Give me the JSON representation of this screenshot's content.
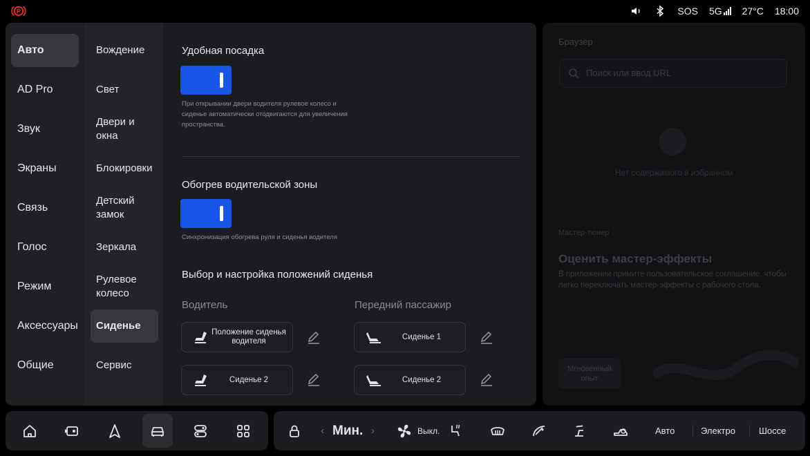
{
  "status_bar": {
    "logo_icon": "parking-brake-icon",
    "volume_icon": "speaker-icon",
    "bluetooth_icon": "bluetooth-icon",
    "sos": "SOS",
    "network": "5G",
    "temperature": "27°C",
    "time": "18:00"
  },
  "nav_primary": {
    "items": [
      {
        "label": "Авто",
        "active": true
      },
      {
        "label": "AD Pro"
      },
      {
        "label": "Звук"
      },
      {
        "label": "Экраны"
      },
      {
        "label": "Связь"
      },
      {
        "label": "Голос"
      },
      {
        "label": "Режим"
      },
      {
        "label": "Аксессуары"
      },
      {
        "label": "Общие"
      }
    ]
  },
  "nav_secondary": {
    "items": [
      {
        "label": "Вождение"
      },
      {
        "label": "Свет"
      },
      {
        "label": "Двери и окна"
      },
      {
        "label": "Блокировки"
      },
      {
        "label": "Детский замок"
      },
      {
        "label": "Зеркала"
      },
      {
        "label": "Рулевое колесо"
      },
      {
        "label": "Сиденье",
        "active": true
      },
      {
        "label": "Сервис"
      }
    ]
  },
  "settings": {
    "easy_entry": {
      "title": "Удобная посадка",
      "enabled": true,
      "description": "При открывании двери водителя рулевое колесо и сиденье автоматически отодвигаются для увеличения пространства."
    },
    "driver_heating": {
      "title": "Обогрев водительской зоны",
      "enabled": true,
      "description": "Синхронизация обогрева руля и сиденья водителя"
    },
    "seat_positions": {
      "title": "Выбор и настройка положений сиденья",
      "driver_header": "Водитель",
      "passenger_header": "Передний пассажир",
      "driver_buttons": [
        "Положение сиденья водителя",
        "Сиденье 2"
      ],
      "passenger_buttons": [
        "Сиденье 1",
        "Сиденье 2"
      ]
    }
  },
  "widget": {
    "title": "Браузер",
    "search_placeholder": "Поиск или ввод URL",
    "empty_text": "Нет содержимого в избранном",
    "tuner_label": "Мастер-тюнер",
    "tuner_heading": "Оценить мастер-эффекты",
    "tuner_text": "В приложении примите пользовательское соглашение, чтобы легко переключать мастер-эффекты с рабочего стола.",
    "card_label": "Мгновенный опыт"
  },
  "dock": {
    "apps": [
      "home-icon",
      "media-icon",
      "navigation-icon",
      "car-icon",
      "toggle-icon",
      "apps-grid-icon"
    ],
    "active_app": "car-icon",
    "fan_level": "Мин.",
    "ac_state": "Выкл.",
    "modes": [
      "Авто",
      "Электро",
      "Шоссе"
    ]
  }
}
